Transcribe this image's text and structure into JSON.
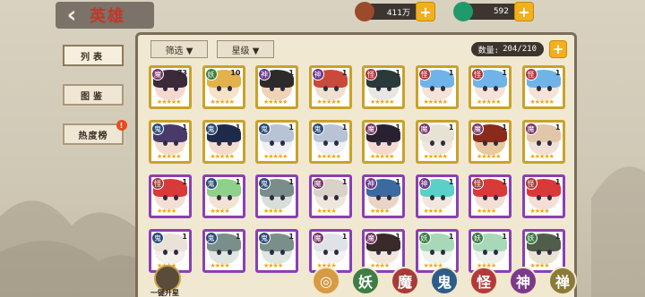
{
  "header": {
    "title": "英雄",
    "back_icon": "chevron-left-icon"
  },
  "resources": [
    {
      "name": "coin",
      "value": "411万",
      "icon": "coin-icon",
      "color": "#9b4a2a"
    },
    {
      "name": "jade",
      "value": "592",
      "icon": "jade-icon",
      "color": "#1f9a6a"
    }
  ],
  "tabs": [
    {
      "label": "列表",
      "active": true
    },
    {
      "label": "图鉴",
      "active": false
    },
    {
      "label": "热度榜",
      "active": false,
      "badge": "!"
    }
  ],
  "filters": {
    "filter_label": "筛选 ▼",
    "star_label": "星级 ▼"
  },
  "count": {
    "label": "数量:",
    "value": "204/210"
  },
  "heroes": [
    {
      "tag": "魔",
      "level": "73",
      "stars": "★★★★★",
      "border": "gold",
      "hair": "#3b2a3a",
      "skin": "#f5d9cf"
    },
    {
      "tag": "妖",
      "level": "10",
      "stars": "★★★★★",
      "border": "gold",
      "hair": "#e3b24a",
      "skin": "#f7e2c8"
    },
    {
      "tag": "神",
      "level": "1",
      "stars": "★★★★★",
      "border": "gold",
      "hair": "#2d2a2a",
      "skin": "#f0d3b5"
    },
    {
      "tag": "神",
      "level": "1",
      "stars": "★★★★★",
      "border": "gold",
      "hair": "#c94a3a",
      "skin": "#f0e0d0"
    },
    {
      "tag": "怪",
      "level": "1",
      "stars": "★★★★★",
      "border": "gold",
      "hair": "#2a3a3a",
      "skin": "#e8e6e2"
    },
    {
      "tag": "怪",
      "level": "1",
      "stars": "★★★★★",
      "border": "gold",
      "hair": "#6fb3e8",
      "skin": "#f5e3d8"
    },
    {
      "tag": "怪",
      "level": "1",
      "stars": "★★★★★",
      "border": "gold",
      "hair": "#6fb3e8",
      "skin": "#f5e3d8"
    },
    {
      "tag": "怪",
      "level": "1",
      "stars": "★★★★★",
      "border": "gold",
      "hair": "#6fb3e8",
      "skin": "#f5e3d8"
    },
    {
      "tag": "鬼",
      "level": "1",
      "stars": "★★★★★",
      "border": "gold",
      "hair": "#4a3a6a",
      "skin": "#f3dccf"
    },
    {
      "tag": "鬼",
      "level": "1",
      "stars": "★★★★★",
      "border": "gold",
      "hair": "#1e2a4a",
      "skin": "#f2dccd"
    },
    {
      "tag": "鬼",
      "level": "1",
      "stars": "★★★★★",
      "border": "gold",
      "hair": "#b9c3d6",
      "skin": "#eef0f5"
    },
    {
      "tag": "鬼",
      "level": "1",
      "stars": "★★★★★",
      "border": "gold",
      "hair": "#b9c3d6",
      "skin": "#eef0f5"
    },
    {
      "tag": "魔",
      "level": "1",
      "stars": "★★★★★",
      "border": "gold",
      "hair": "#2a2130",
      "skin": "#f5d9cf"
    },
    {
      "tag": "魔",
      "level": "1",
      "stars": "★★★★★",
      "border": "gold",
      "hair": "#e8e2d5",
      "skin": "#f0e6dc"
    },
    {
      "tag": "魔",
      "level": "1",
      "stars": "★★★★★",
      "border": "gold",
      "hair": "#8a2a1a",
      "skin": "#e8c9a0"
    },
    {
      "tag": "魔",
      "level": "1",
      "stars": "★★★★★",
      "border": "gold",
      "hair": "#e2c6a8",
      "skin": "#f0e0d5"
    },
    {
      "tag": "怪",
      "level": "1",
      "stars": "★★★★",
      "border": "purple",
      "hair": "#d83a3a",
      "skin": "#f5dfd5"
    },
    {
      "tag": "鬼",
      "level": "1",
      "stars": "★★★★",
      "border": "purple",
      "hair": "#8fd08a",
      "skin": "#f2e3d5"
    },
    {
      "tag": "鬼",
      "level": "1",
      "stars": "★★★★",
      "border": "purple",
      "hair": "#7b8d8a",
      "skin": "#d8dfd8"
    },
    {
      "tag": "魔",
      "level": "1",
      "stars": "★★★★",
      "border": "purple",
      "hair": "#d8d2c8",
      "skin": "#efe7dc"
    },
    {
      "tag": "神",
      "level": "1",
      "stars": "★★★★",
      "border": "purple",
      "hair": "#3a6aa0",
      "skin": "#e8d5c5"
    },
    {
      "tag": "神",
      "level": "1",
      "stars": "★★★★",
      "border": "purple",
      "hair": "#5ad0c8",
      "skin": "#f0e8df"
    },
    {
      "tag": "怪",
      "level": "1",
      "stars": "★★★★",
      "border": "purple",
      "hair": "#d83a3a",
      "skin": "#f5dfd5"
    },
    {
      "tag": "怪",
      "level": "1",
      "stars": "★★★★",
      "border": "purple",
      "hair": "#d83a3a",
      "skin": "#f5dfd5"
    },
    {
      "tag": "鬼",
      "level": "1",
      "stars": "★★★★",
      "border": "purple",
      "hair": "#e8e2d8",
      "skin": "#f4efe8"
    },
    {
      "tag": "鬼",
      "level": "1",
      "stars": "★★★★",
      "border": "purple",
      "hair": "#7a8f8a",
      "skin": "#dfe5df"
    },
    {
      "tag": "鬼",
      "level": "1",
      "stars": "★★★★",
      "border": "purple",
      "hair": "#7a8f8a",
      "skin": "#dfe5df"
    },
    {
      "tag": "魔",
      "level": "1",
      "stars": "★★★★",
      "border": "purple",
      "hair": "#dfe3e8",
      "skin": "#f2f2f2"
    },
    {
      "tag": "魔",
      "level": "1",
      "stars": "★★★★",
      "border": "purple",
      "hair": "#3a2a2a",
      "skin": "#f2e6da"
    },
    {
      "tag": "妖",
      "level": "1",
      "stars": "★★★★",
      "border": "purple",
      "hair": "#a8d8b8",
      "skin": "#eef2ea"
    },
    {
      "tag": "妖",
      "level": "1",
      "stars": "★★★★",
      "border": "purple",
      "hair": "#a8d8b8",
      "skin": "#eef2ea"
    },
    {
      "tag": "妖",
      "level": "1",
      "stars": "★★★★",
      "border": "purple",
      "hair": "#4f5d4a",
      "skin": "#e8e2d0"
    }
  ],
  "bottom": {
    "upstar_label": "一键升星",
    "categories": [
      {
        "label": "◎",
        "name": "all",
        "color": "#d79a45"
      },
      {
        "label": "妖",
        "name": "yao",
        "color": "#3e7d45"
      },
      {
        "label": "魔",
        "name": "mo",
        "color": "#a83a3a"
      },
      {
        "label": "鬼",
        "name": "gui",
        "color": "#2e5c8a"
      },
      {
        "label": "怪",
        "name": "guai",
        "color": "#b23a3a"
      },
      {
        "label": "神",
        "name": "shen",
        "color": "#7b3a8a"
      },
      {
        "label": "禅",
        "name": "chan",
        "color": "#8a7b3a"
      }
    ]
  }
}
